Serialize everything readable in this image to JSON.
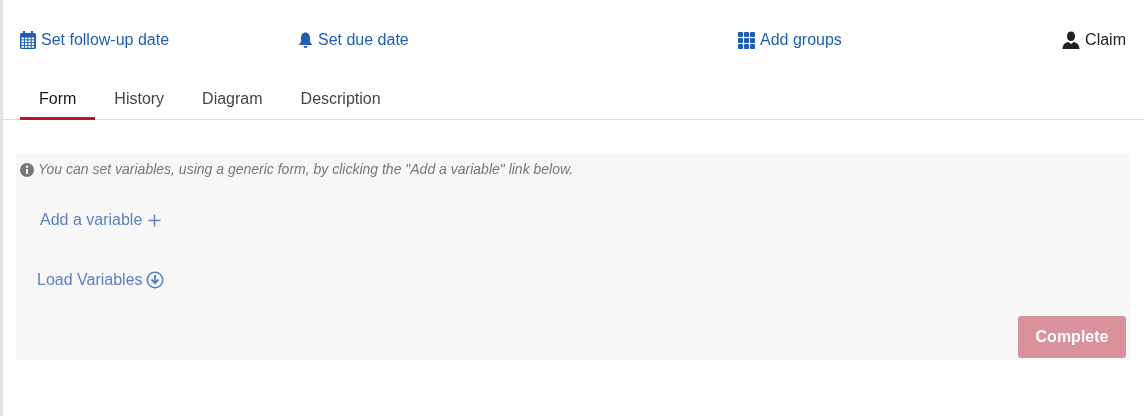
{
  "actions": [
    {
      "kind": "calendar",
      "label": "Set follow-up date"
    },
    {
      "kind": "bell",
      "label": "Set due date"
    },
    {
      "kind": "groups",
      "label": "Add groups"
    },
    {
      "kind": "user",
      "label": "Claim"
    }
  ],
  "tabs": [
    {
      "label": "Form",
      "selected": true
    },
    {
      "label": "History",
      "selected": false
    },
    {
      "label": "Diagram",
      "selected": false
    },
    {
      "label": "Description",
      "selected": false
    }
  ],
  "form": {
    "hint": "You can set variables, using a generic form, by clicking the \"Add a variable\" link below.",
    "add_link": "Add a variable",
    "load_link": "Load Variables",
    "complete_button": {
      "label": "Complete",
      "disabled": true
    }
  }
}
